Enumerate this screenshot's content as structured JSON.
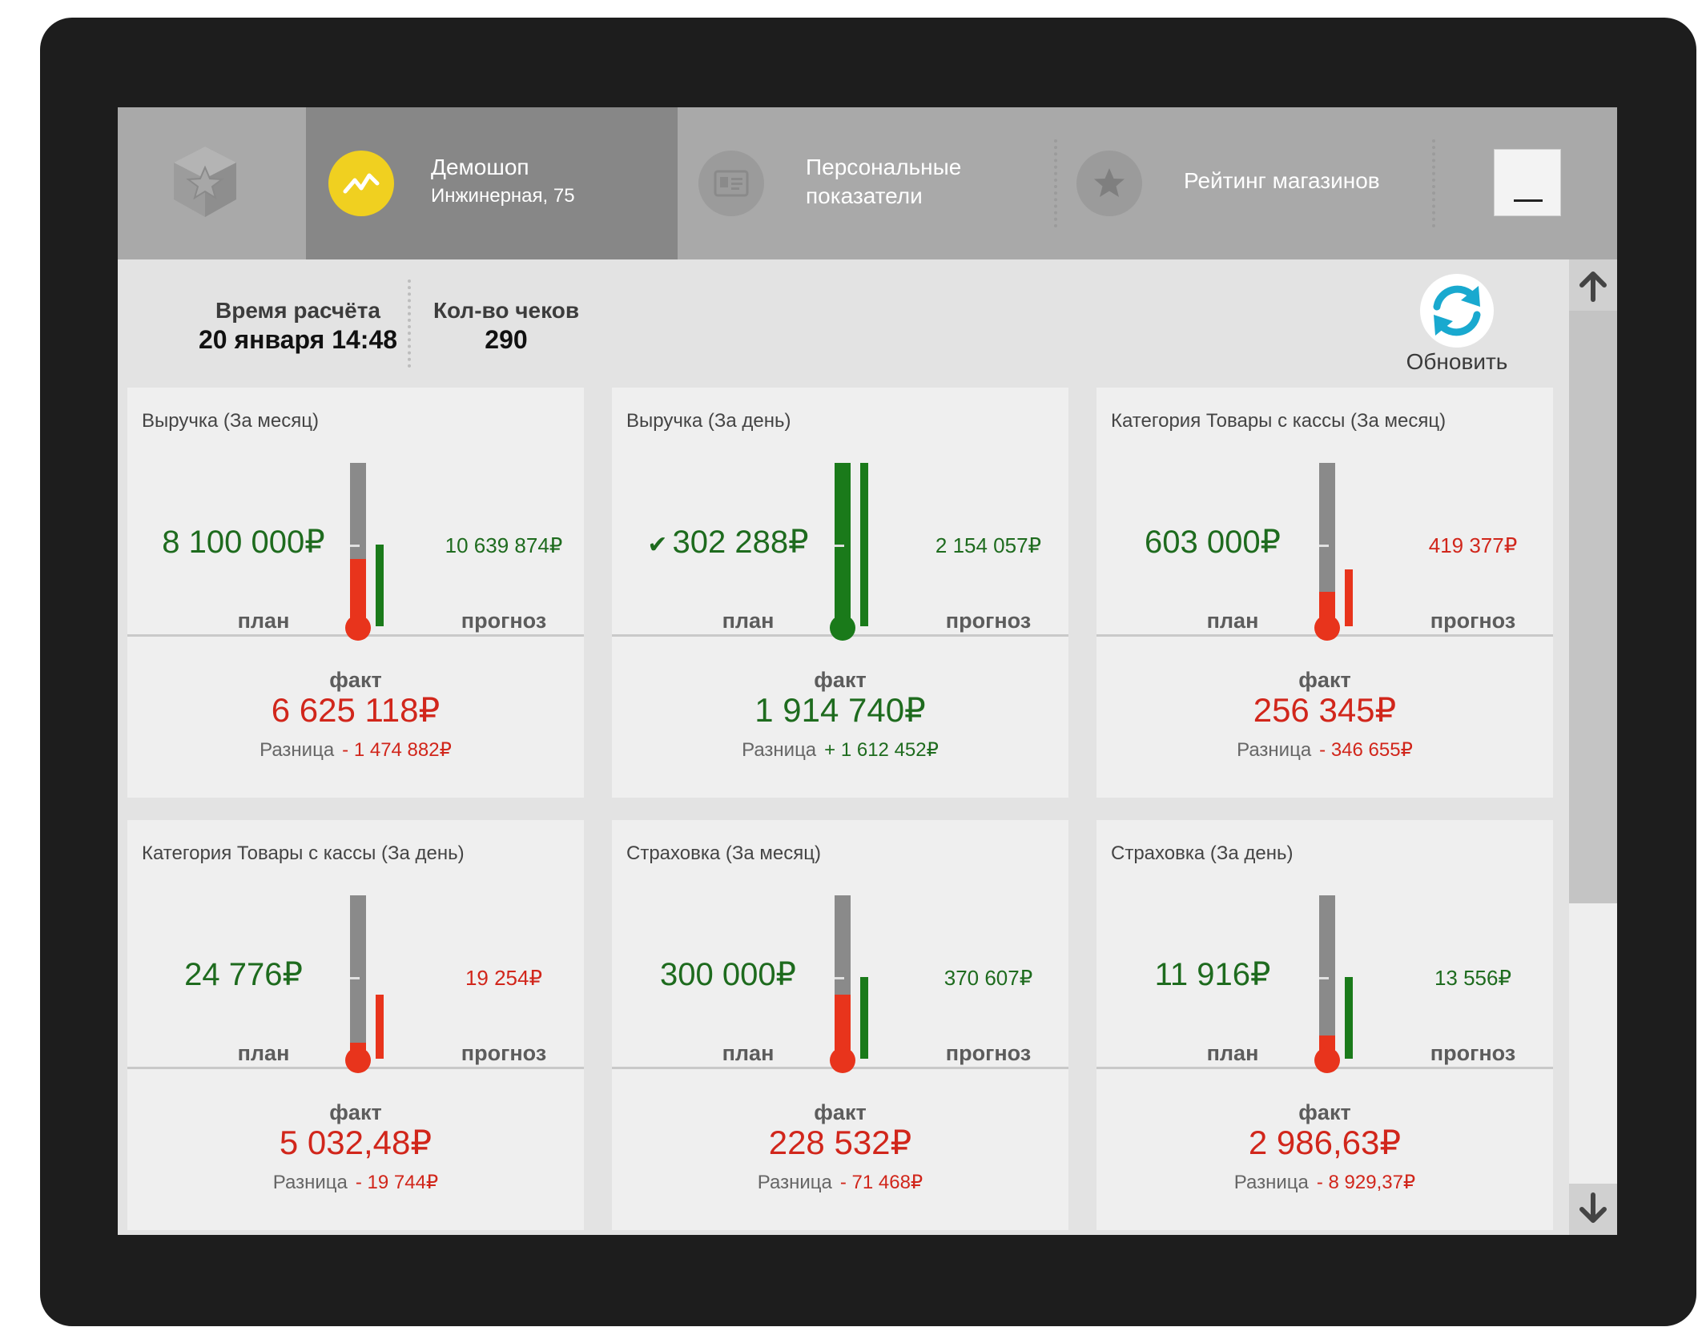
{
  "header": {
    "store_name": "Демошоп",
    "store_address": "Инжинерная, 75",
    "tab_personal_line1": "Персональные",
    "tab_personal_line2": "показатели",
    "tab_rating": "Рейтинг магазинов",
    "active_accent": "#f0d020"
  },
  "info": {
    "calc_time_label": "Время расчёта",
    "calc_time_value": "20 января 14:48",
    "checks_label": "Кол-во чеков",
    "checks_value": "290",
    "refresh_label": "Обновить"
  },
  "labels": {
    "plan": "план",
    "forecast": "прогноз",
    "fact": "факт",
    "difference": "Разница"
  },
  "cards": [
    {
      "title": "Выручка (За месяц)",
      "plan": "8 100 000₽",
      "plan_met": false,
      "forecast": "10 639 874₽",
      "forecast_status": "green",
      "fact": "6 625 118₽",
      "fact_status": "red",
      "difference": "- 1 474 882₽",
      "difference_status": "red",
      "fact_ratio": 0.41,
      "forecast_ratio": 0.5
    },
    {
      "title": "Выручка (За день)",
      "plan": "302 288₽",
      "plan_met": true,
      "forecast": "2 154 057₽",
      "forecast_status": "green",
      "fact": "1 914 740₽",
      "fact_status": "green",
      "difference": "+ 1 612 452₽",
      "difference_status": "green",
      "fact_ratio": 1.0,
      "forecast_ratio": 1.0
    },
    {
      "title": "Категория Товары  с кассы (За месяц)",
      "plan": "603 000₽",
      "plan_met": false,
      "forecast": "419 377₽",
      "forecast_status": "red",
      "fact": "256 345₽",
      "fact_status": "red",
      "difference": "- 346 655₽",
      "difference_status": "red",
      "fact_ratio": 0.21,
      "forecast_ratio": 0.35
    },
    {
      "title": "Категория Товары  с кассы (За день)",
      "plan": "24 776₽",
      "plan_met": false,
      "forecast": "19 254₽",
      "forecast_status": "red",
      "fact": "5 032,48₽",
      "fact_status": "red",
      "difference": "- 19 744₽",
      "difference_status": "red",
      "fact_ratio": 0.1,
      "forecast_ratio": 0.39
    },
    {
      "title": "Страховка (За месяц)",
      "plan": "300 000₽",
      "plan_met": false,
      "forecast": "370 607₽",
      "forecast_status": "green",
      "fact": "228 532₽",
      "fact_status": "red",
      "difference": "- 71 468₽",
      "difference_status": "red",
      "fact_ratio": 0.39,
      "forecast_ratio": 0.5
    },
    {
      "title": "Страховка (За день)",
      "plan": "11 916₽",
      "plan_met": false,
      "forecast": "13 556₽",
      "forecast_status": "green",
      "fact": "2 986,63₽",
      "fact_status": "red",
      "difference": "- 8 929,37₽",
      "difference_status": "red",
      "fact_ratio": 0.14,
      "forecast_ratio": 0.5
    }
  ],
  "colors": {
    "green": "#1e6b1e",
    "bar_green": "#1a7a1a",
    "red": "#d1261b",
    "bar_red": "#e8341c",
    "tube_gray": "#8a8a8a",
    "refresh_cyan": "#19a9cf"
  }
}
